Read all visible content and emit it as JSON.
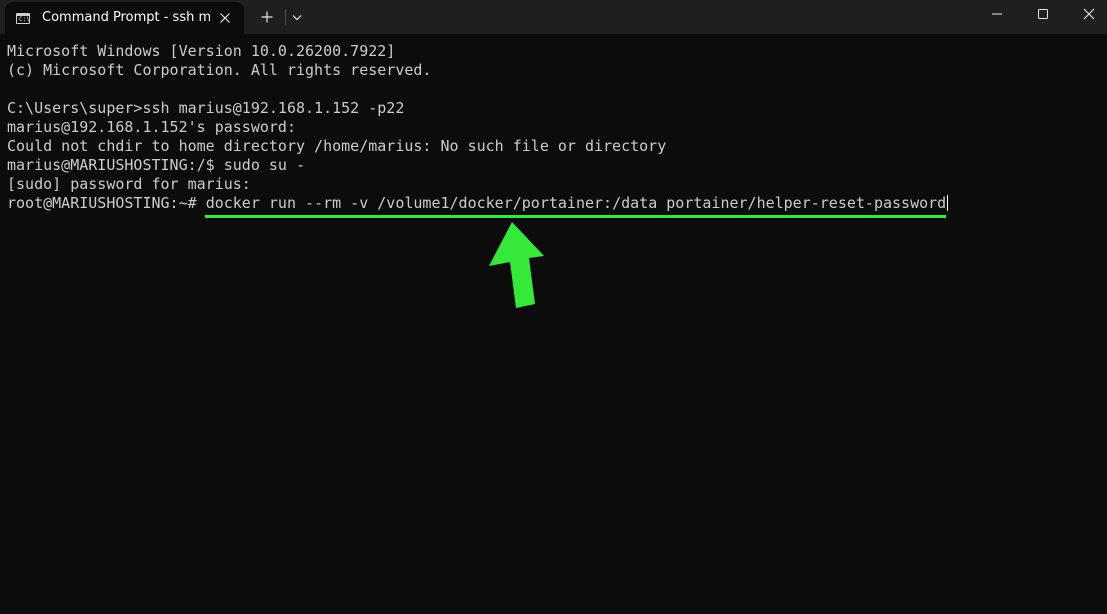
{
  "window": {
    "tab_title": "Command Prompt - ssh  mari",
    "tab_icon": "cmd-icon",
    "icons": {
      "close_tab": "close-icon",
      "new_tab": "plus-icon",
      "dropdown": "chevron-down-icon",
      "minimize": "minimize-icon",
      "maximize": "maximize-icon",
      "close_window": "close-icon"
    }
  },
  "terminal": {
    "lines": [
      "Microsoft Windows [Version 10.0.26200.7922]",
      "(c) Microsoft Corporation. All rights reserved.",
      "",
      "C:\\Users\\super>ssh marius@192.168.1.152 -p22",
      "marius@192.168.1.152's password:",
      "Could not chdir to home directory /home/marius: No such file or directory",
      "marius@MARIUSHOSTING:/$ sudo su -",
      "[sudo] password for marius:"
    ],
    "prompt": "root@MARIUSHOSTING:~# ",
    "current_command": "docker run --rm -v /volume1/docker/portainer:/data portainer/helper-reset-password"
  },
  "annotation": {
    "highlight_color": "#36e83a",
    "arrow_icon": "arrow-up-icon"
  }
}
